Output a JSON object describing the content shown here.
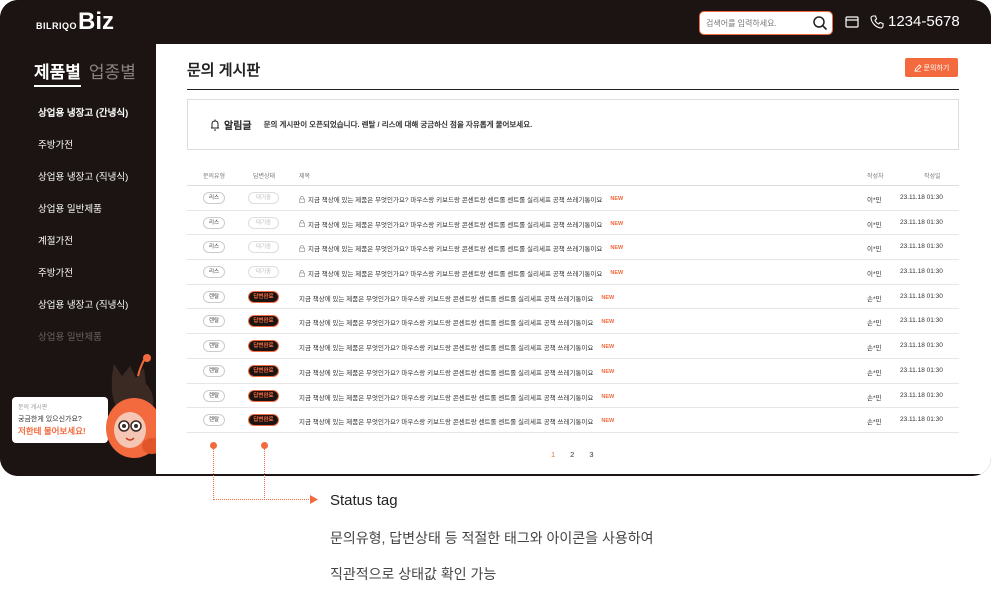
{
  "header": {
    "logo_small": "BILRIQO",
    "logo_big": "Biz",
    "search_placeholder": "검색어를 입력하세요.",
    "phone": "1234-5678"
  },
  "sidebar": {
    "tabs": [
      "제품별",
      "업종별"
    ],
    "items": [
      "상업용 냉장고 (간냉식)",
      "주방가전",
      "상업용 냉장고 (직냉식)",
      "상업용 일반제품",
      "계절가전",
      "주방가전",
      "상업용 냉장고 (직냉식)",
      "상업용 일반제품"
    ],
    "promo": {
      "small": "문의 게시판",
      "mid": "궁금한게 있으신가요?",
      "big": "저한테 물어보세요!"
    }
  },
  "main": {
    "title": "문의 게시판",
    "write_button": "문의하기",
    "notice_label": "알림글",
    "notice_text": "문의 게시판이 오픈되었습니다. 렌탈 / 리스에 대해 궁금하신 점을 자유롭게 물어보세요.",
    "columns": [
      "문의유형",
      "답변상태",
      "제목",
      "작성자",
      "작성일"
    ],
    "rows": [
      {
        "type": "리스",
        "status": "대기중",
        "title": "지금 책상에 있는 제품은 무엇인가요? 마우스랑 키보드랑 콘센트랑 센트롤 센트롤 실리세프 공책 쓰레기통이요",
        "new": "NEW",
        "author": "이*민",
        "date": "23.11.18 01:30"
      },
      {
        "type": "리스",
        "status": "대기중",
        "title": "지금 책상에 있는 제품은 무엇인가요? 마우스랑 키보드랑 콘센트랑 센트롤 센트롤 실리세프 공책 쓰레기통이요",
        "new": "NEW",
        "author": "이*민",
        "date": "23.11.18 01:30"
      },
      {
        "type": "리스",
        "status": "대기중",
        "title": "지금 책상에 있는 제품은 무엇인가요? 마우스랑 키보드랑 콘센트랑 센트롤 센트롤 실리세프 공책 쓰레기통이요",
        "new": "NEW",
        "author": "이*민",
        "date": "23.11.18 01:30"
      },
      {
        "type": "리스",
        "status": "대기중",
        "title": "지금 책상에 있는 제품은 무엇인가요? 마우스랑 키보드랑 콘센트랑 센트롤 센트롤 실리세프 공책 쓰레기통이요",
        "new": "NEW",
        "author": "이*민",
        "date": "23.11.18 01:30"
      },
      {
        "type": "렌탈",
        "status": "답변완료",
        "title": "지금 책상에 있는 제품은 무엇인가요? 마우스랑 키보드랑 콘센트랑 센트롤 센트롤 실리세프 공책 쓰레기통이요",
        "new": "NEW",
        "author": "손*민",
        "date": "23.11.18 01:30"
      },
      {
        "type": "렌탈",
        "status": "답변완료",
        "title": "지금 책상에 있는 제품은 무엇인가요? 마우스랑 키보드랑 콘센트랑 센트롤 센트롤 실리세프 공책 쓰레기통이요",
        "new": "NEW",
        "author": "손*민",
        "date": "23.11.18 01:30"
      },
      {
        "type": "렌탈",
        "status": "답변완료",
        "title": "지금 책상에 있는 제품은 무엇인가요? 마우스랑 키보드랑 콘센트랑 센트롤 센트롤 실리세프 공책 쓰레기통이요",
        "new": "NEW",
        "author": "손*민",
        "date": "23.11.18 01:30"
      },
      {
        "type": "렌탈",
        "status": "답변완료",
        "title": "지금 책상에 있는 제품은 무엇인가요? 마우스랑 키보드랑 콘센트랑 센트롤 센트롤 실리세프 공책 쓰레기통이요",
        "new": "NEW",
        "author": "손*민",
        "date": "23.11.18 01:30"
      },
      {
        "type": "렌탈",
        "status": "답변완료",
        "title": "지금 책상에 있는 제품은 무엇인가요? 마우스랑 키보드랑 콘센트랑 센트롤 센트롤 실리세프 공책 쓰레기통이요",
        "new": "NEW",
        "author": "손*민",
        "date": "23.11.18 01:30"
      },
      {
        "type": "렌탈",
        "status": "답변완료",
        "title": "지금 책상에 있는 제품은 무엇인가요? 마우스랑 키보드랑 콘센트랑 센트롤 센트롤 실리세프 공책 쓰레기통이요",
        "new": "NEW",
        "author": "손*민",
        "date": "23.11.18 01:30"
      }
    ],
    "pages": [
      "1",
      "2",
      "3"
    ]
  },
  "callout": {
    "title": "Status tag",
    "desc_line1": "문의유형, 답변상태 등 적절한 태그와 아이콘을 사용하여",
    "desc_line2": "직관적으로 상태값 확인 가능"
  },
  "colors": {
    "accent": "#f26a3d",
    "dark": "#1b1412"
  }
}
